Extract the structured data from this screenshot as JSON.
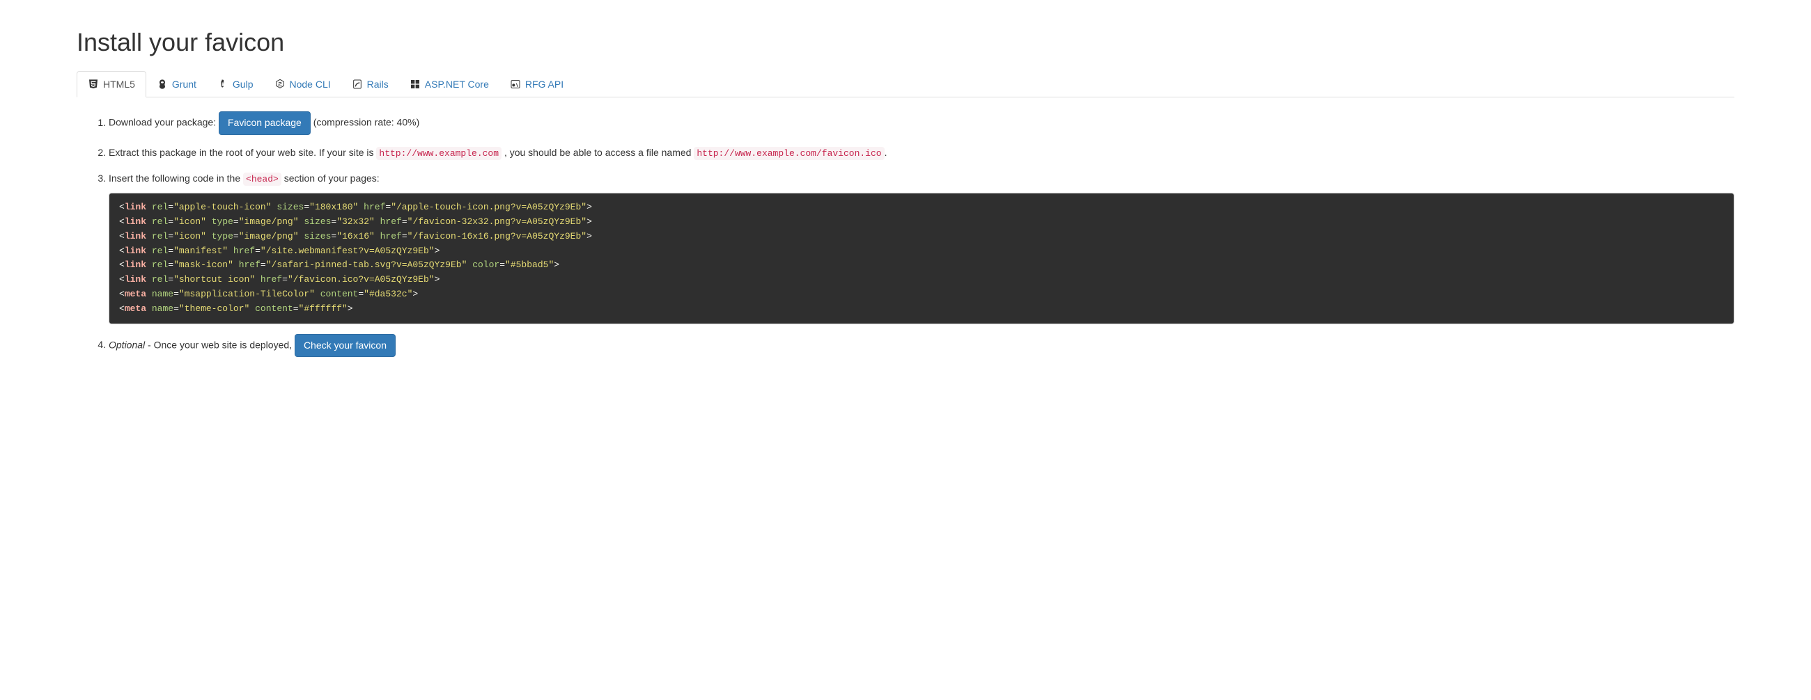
{
  "title": "Install your favicon",
  "tabs": [
    {
      "label": "HTML5"
    },
    {
      "label": "Grunt"
    },
    {
      "label": "Gulp"
    },
    {
      "label": "Node CLI"
    },
    {
      "label": "Rails"
    },
    {
      "label": "ASP.NET Core"
    },
    {
      "label": "RFG API"
    }
  ],
  "steps": {
    "s1_prefix": "Download your package:",
    "s1_button": "Favicon package",
    "s1_suffix": "(compression rate: 40%)",
    "s2_prefix": "Extract this package in the root of your web site. If your site is ",
    "s2_code1": "http://www.example.com",
    "s2_mid": ", you should be able to access a file named ",
    "s2_code2": "http://www.example.com/favicon.ico",
    "s2_suffix": ".",
    "s3_prefix": "Insert the following code in the ",
    "s3_code": "<head>",
    "s3_suffix": " section of your pages:",
    "s4_optional": "Optional",
    "s4_text": " - Once your web site is deployed, ",
    "s4_button": "Check your favicon"
  },
  "code_lines": [
    [
      {
        "t": "tag",
        "v": "<"
      },
      {
        "t": "name",
        "v": "link"
      },
      {
        "t": "tag",
        "v": " "
      },
      {
        "t": "attr",
        "v": "rel"
      },
      {
        "t": "tag",
        "v": "="
      },
      {
        "t": "val",
        "v": "\"apple-touch-icon\""
      },
      {
        "t": "tag",
        "v": " "
      },
      {
        "t": "attr",
        "v": "sizes"
      },
      {
        "t": "tag",
        "v": "="
      },
      {
        "t": "val",
        "v": "\"180x180\""
      },
      {
        "t": "tag",
        "v": " "
      },
      {
        "t": "attr",
        "v": "href"
      },
      {
        "t": "tag",
        "v": "="
      },
      {
        "t": "val",
        "v": "\"/apple-touch-icon.png?v=A05zQYz9Eb\""
      },
      {
        "t": "tag",
        "v": ">"
      }
    ],
    [
      {
        "t": "tag",
        "v": "<"
      },
      {
        "t": "name",
        "v": "link"
      },
      {
        "t": "tag",
        "v": " "
      },
      {
        "t": "attr",
        "v": "rel"
      },
      {
        "t": "tag",
        "v": "="
      },
      {
        "t": "val",
        "v": "\"icon\""
      },
      {
        "t": "tag",
        "v": " "
      },
      {
        "t": "attr",
        "v": "type"
      },
      {
        "t": "tag",
        "v": "="
      },
      {
        "t": "val",
        "v": "\"image/png\""
      },
      {
        "t": "tag",
        "v": " "
      },
      {
        "t": "attr",
        "v": "sizes"
      },
      {
        "t": "tag",
        "v": "="
      },
      {
        "t": "val",
        "v": "\"32x32\""
      },
      {
        "t": "tag",
        "v": " "
      },
      {
        "t": "attr",
        "v": "href"
      },
      {
        "t": "tag",
        "v": "="
      },
      {
        "t": "val",
        "v": "\"/favicon-32x32.png?v=A05zQYz9Eb\""
      },
      {
        "t": "tag",
        "v": ">"
      }
    ],
    [
      {
        "t": "tag",
        "v": "<"
      },
      {
        "t": "name",
        "v": "link"
      },
      {
        "t": "tag",
        "v": " "
      },
      {
        "t": "attr",
        "v": "rel"
      },
      {
        "t": "tag",
        "v": "="
      },
      {
        "t": "val",
        "v": "\"icon\""
      },
      {
        "t": "tag",
        "v": " "
      },
      {
        "t": "attr",
        "v": "type"
      },
      {
        "t": "tag",
        "v": "="
      },
      {
        "t": "val",
        "v": "\"image/png\""
      },
      {
        "t": "tag",
        "v": " "
      },
      {
        "t": "attr",
        "v": "sizes"
      },
      {
        "t": "tag",
        "v": "="
      },
      {
        "t": "val",
        "v": "\"16x16\""
      },
      {
        "t": "tag",
        "v": " "
      },
      {
        "t": "attr",
        "v": "href"
      },
      {
        "t": "tag",
        "v": "="
      },
      {
        "t": "val",
        "v": "\"/favicon-16x16.png?v=A05zQYz9Eb\""
      },
      {
        "t": "tag",
        "v": ">"
      }
    ],
    [
      {
        "t": "tag",
        "v": "<"
      },
      {
        "t": "name",
        "v": "link"
      },
      {
        "t": "tag",
        "v": " "
      },
      {
        "t": "attr",
        "v": "rel"
      },
      {
        "t": "tag",
        "v": "="
      },
      {
        "t": "val",
        "v": "\"manifest\""
      },
      {
        "t": "tag",
        "v": " "
      },
      {
        "t": "attr",
        "v": "href"
      },
      {
        "t": "tag",
        "v": "="
      },
      {
        "t": "val",
        "v": "\"/site.webmanifest?v=A05zQYz9Eb\""
      },
      {
        "t": "tag",
        "v": ">"
      }
    ],
    [
      {
        "t": "tag",
        "v": "<"
      },
      {
        "t": "name",
        "v": "link"
      },
      {
        "t": "tag",
        "v": " "
      },
      {
        "t": "attr",
        "v": "rel"
      },
      {
        "t": "tag",
        "v": "="
      },
      {
        "t": "val",
        "v": "\"mask-icon\""
      },
      {
        "t": "tag",
        "v": " "
      },
      {
        "t": "attr",
        "v": "href"
      },
      {
        "t": "tag",
        "v": "="
      },
      {
        "t": "val",
        "v": "\"/safari-pinned-tab.svg?v=A05zQYz9Eb\""
      },
      {
        "t": "tag",
        "v": " "
      },
      {
        "t": "attr",
        "v": "color"
      },
      {
        "t": "tag",
        "v": "="
      },
      {
        "t": "val",
        "v": "\"#5bbad5\""
      },
      {
        "t": "tag",
        "v": ">"
      }
    ],
    [
      {
        "t": "tag",
        "v": "<"
      },
      {
        "t": "name",
        "v": "link"
      },
      {
        "t": "tag",
        "v": " "
      },
      {
        "t": "attr",
        "v": "rel"
      },
      {
        "t": "tag",
        "v": "="
      },
      {
        "t": "val",
        "v": "\"shortcut icon\""
      },
      {
        "t": "tag",
        "v": " "
      },
      {
        "t": "attr",
        "v": "href"
      },
      {
        "t": "tag",
        "v": "="
      },
      {
        "t": "val",
        "v": "\"/favicon.ico?v=A05zQYz9Eb\""
      },
      {
        "t": "tag",
        "v": ">"
      }
    ],
    [
      {
        "t": "tag",
        "v": "<"
      },
      {
        "t": "name",
        "v": "meta"
      },
      {
        "t": "tag",
        "v": " "
      },
      {
        "t": "attr",
        "v": "name"
      },
      {
        "t": "tag",
        "v": "="
      },
      {
        "t": "val",
        "v": "\"msapplication-TileColor\""
      },
      {
        "t": "tag",
        "v": " "
      },
      {
        "t": "attr",
        "v": "content"
      },
      {
        "t": "tag",
        "v": "="
      },
      {
        "t": "val",
        "v": "\"#da532c\""
      },
      {
        "t": "tag",
        "v": ">"
      }
    ],
    [
      {
        "t": "tag",
        "v": "<"
      },
      {
        "t": "name",
        "v": "meta"
      },
      {
        "t": "tag",
        "v": " "
      },
      {
        "t": "attr",
        "v": "name"
      },
      {
        "t": "tag",
        "v": "="
      },
      {
        "t": "val",
        "v": "\"theme-color\""
      },
      {
        "t": "tag",
        "v": " "
      },
      {
        "t": "attr",
        "v": "content"
      },
      {
        "t": "tag",
        "v": "="
      },
      {
        "t": "val",
        "v": "\"#ffffff\""
      },
      {
        "t": "tag",
        "v": ">"
      }
    ]
  ]
}
